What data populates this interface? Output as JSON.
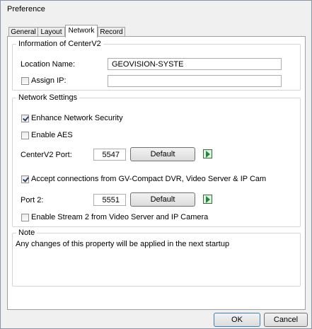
{
  "window": {
    "title": "Preference"
  },
  "tabs": [
    {
      "label": "General"
    },
    {
      "label": "Layout"
    },
    {
      "label": "Network",
      "active": true
    },
    {
      "label": "Record"
    }
  ],
  "info_group": {
    "legend": "Information of CenterV2",
    "location_label": "Location Name:",
    "location_value": "GEOVISION-SYSTE",
    "assign_ip_label": "Assign IP:",
    "assign_ip_checked": false,
    "assign_ip_value": ""
  },
  "network_group": {
    "legend": "Network Settings",
    "enhance_security_label": "Enhance Network Security",
    "enhance_security_checked": true,
    "enable_aes_label": "Enable AES",
    "enable_aes_checked": false,
    "centerv2_port_label": "CenterV2 Port:",
    "centerv2_port_value": "5547",
    "default_label": "Default",
    "accept_label": "Accept connections from GV-Compact DVR, Video Server & IP Cam",
    "accept_checked": true,
    "port2_label": "Port 2:",
    "port2_value": "5551",
    "default2_label": "Default",
    "stream2_label": "Enable Stream 2 from Video Server and IP Camera",
    "stream2_checked": false
  },
  "note_group": {
    "legend": "Note",
    "text": "Any changes of this property will be applied in the next startup"
  },
  "footer": {
    "ok_label": "OK",
    "cancel_label": "Cancel"
  }
}
